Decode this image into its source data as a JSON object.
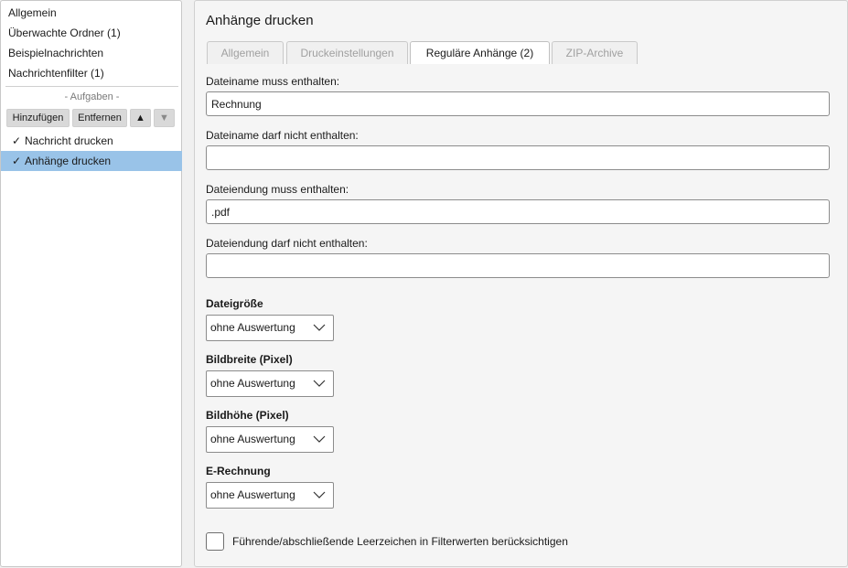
{
  "sidebar": {
    "items": [
      {
        "label": "Allgemein"
      },
      {
        "label": "Überwachte Ordner (1)"
      },
      {
        "label": "Beispielnachrichten"
      },
      {
        "label": "Nachrichtenfilter (1)"
      }
    ],
    "tasks_label": "- Aufgaben -",
    "buttons": {
      "add": "Hinzufügen",
      "remove": "Entfernen",
      "up": "▲",
      "down": "▼"
    },
    "tasks": [
      {
        "check": "✓",
        "label": "Nachricht drucken",
        "selected": false
      },
      {
        "check": "✓",
        "label": "Anhänge drucken",
        "selected": true
      }
    ]
  },
  "main": {
    "title": "Anhänge drucken",
    "tabs": [
      {
        "label": "Allgemein",
        "active": false
      },
      {
        "label": "Druckeinstellungen",
        "active": false
      },
      {
        "label": "Reguläre Anhänge (2)",
        "active": true
      },
      {
        "label": "ZIP-Archive",
        "active": false
      }
    ],
    "filename_must_contain": {
      "label": "Dateiname muss enthalten:",
      "value": "Rechnung"
    },
    "filename_must_not_contain": {
      "label": "Dateiname darf nicht enthalten:",
      "value": ""
    },
    "extension_must_contain": {
      "label": "Dateiendung muss enthalten:",
      "value": ".pdf"
    },
    "extension_must_not_contain": {
      "label": "Dateiendung darf nicht enthalten:",
      "value": ""
    },
    "filesize": {
      "label": "Dateigröße",
      "value": "ohne Auswertung"
    },
    "image_width": {
      "label": "Bildbreite (Pixel)",
      "value": "ohne Auswertung"
    },
    "image_height": {
      "label": "Bildhöhe (Pixel)",
      "value": "ohne Auswertung"
    },
    "e_invoice": {
      "label": "E-Rechnung",
      "value": "ohne Auswertung"
    },
    "whitespace_option": {
      "label": "Führende/abschließende Leerzeichen in Filterwerten berücksichtigen",
      "checked": false
    }
  },
  "colors": {
    "selection": "#99c3e8",
    "button_bg": "#d9d9d9",
    "panel_bg": "#f5f5f5"
  }
}
